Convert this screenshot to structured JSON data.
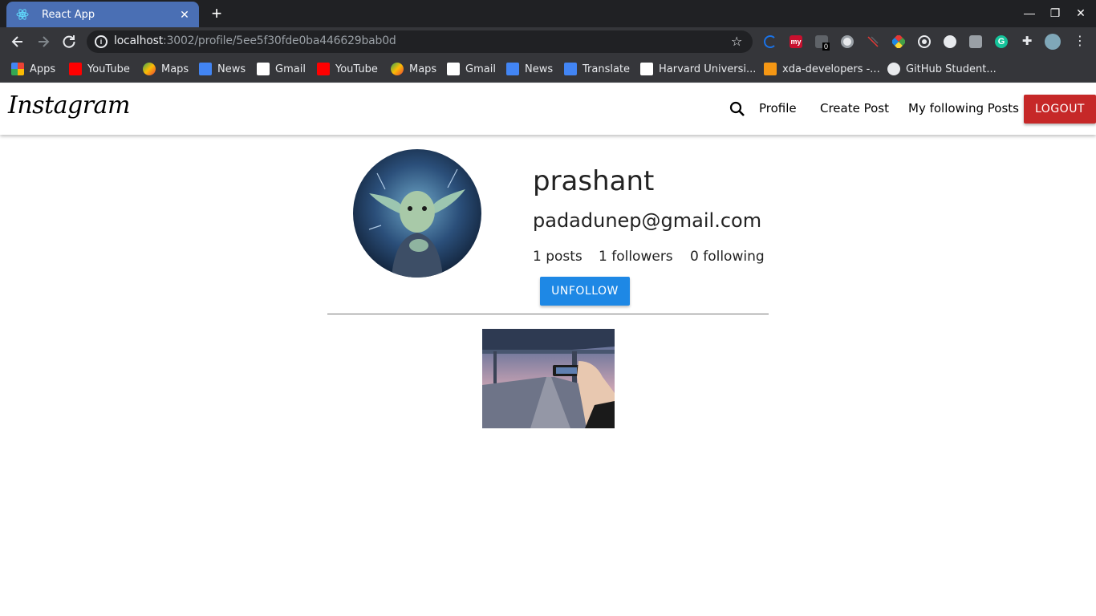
{
  "browser": {
    "tab_title": "React App",
    "new_tab_symbol": "+",
    "url_host": "localhost",
    "url_path": ":3002/profile/5ee5f30fde0ba446629bab0d",
    "extension_badge": "0",
    "extension_my_label": "my",
    "bookmarks": [
      {
        "label": "Apps",
        "icon": "apps-grid-icon"
      },
      {
        "label": "YouTube",
        "icon": "youtube-icon"
      },
      {
        "label": "Maps",
        "icon": "maps-icon"
      },
      {
        "label": "News",
        "icon": "news-icon"
      },
      {
        "label": "Gmail",
        "icon": "gmail-icon"
      },
      {
        "label": "YouTube",
        "icon": "youtube-icon"
      },
      {
        "label": "Maps",
        "icon": "maps-icon"
      },
      {
        "label": "Gmail",
        "icon": "gmail-icon"
      },
      {
        "label": "News",
        "icon": "news-icon"
      },
      {
        "label": "Translate",
        "icon": "translate-icon"
      },
      {
        "label": "Harvard Universi...",
        "icon": "edx-icon"
      },
      {
        "label": "xda-developers -...",
        "icon": "xda-icon"
      },
      {
        "label": "GitHub Student...",
        "icon": "github-icon"
      }
    ]
  },
  "app": {
    "brand": "Instagram",
    "nav": {
      "profile": "Profile",
      "create_post": "Create Post",
      "following_posts": "My following Posts",
      "logout": "LOGOUT"
    },
    "profile": {
      "username": "prashant",
      "email": "padadunep@gmail.com",
      "posts": "1 posts",
      "followers": "1 followers",
      "following": "0 following",
      "action": "UNFOLLOW"
    }
  },
  "colors": {
    "tab_active": "#4a6fb4",
    "logout_button": "#c62828",
    "unfollow_button": "#1e88e5"
  }
}
